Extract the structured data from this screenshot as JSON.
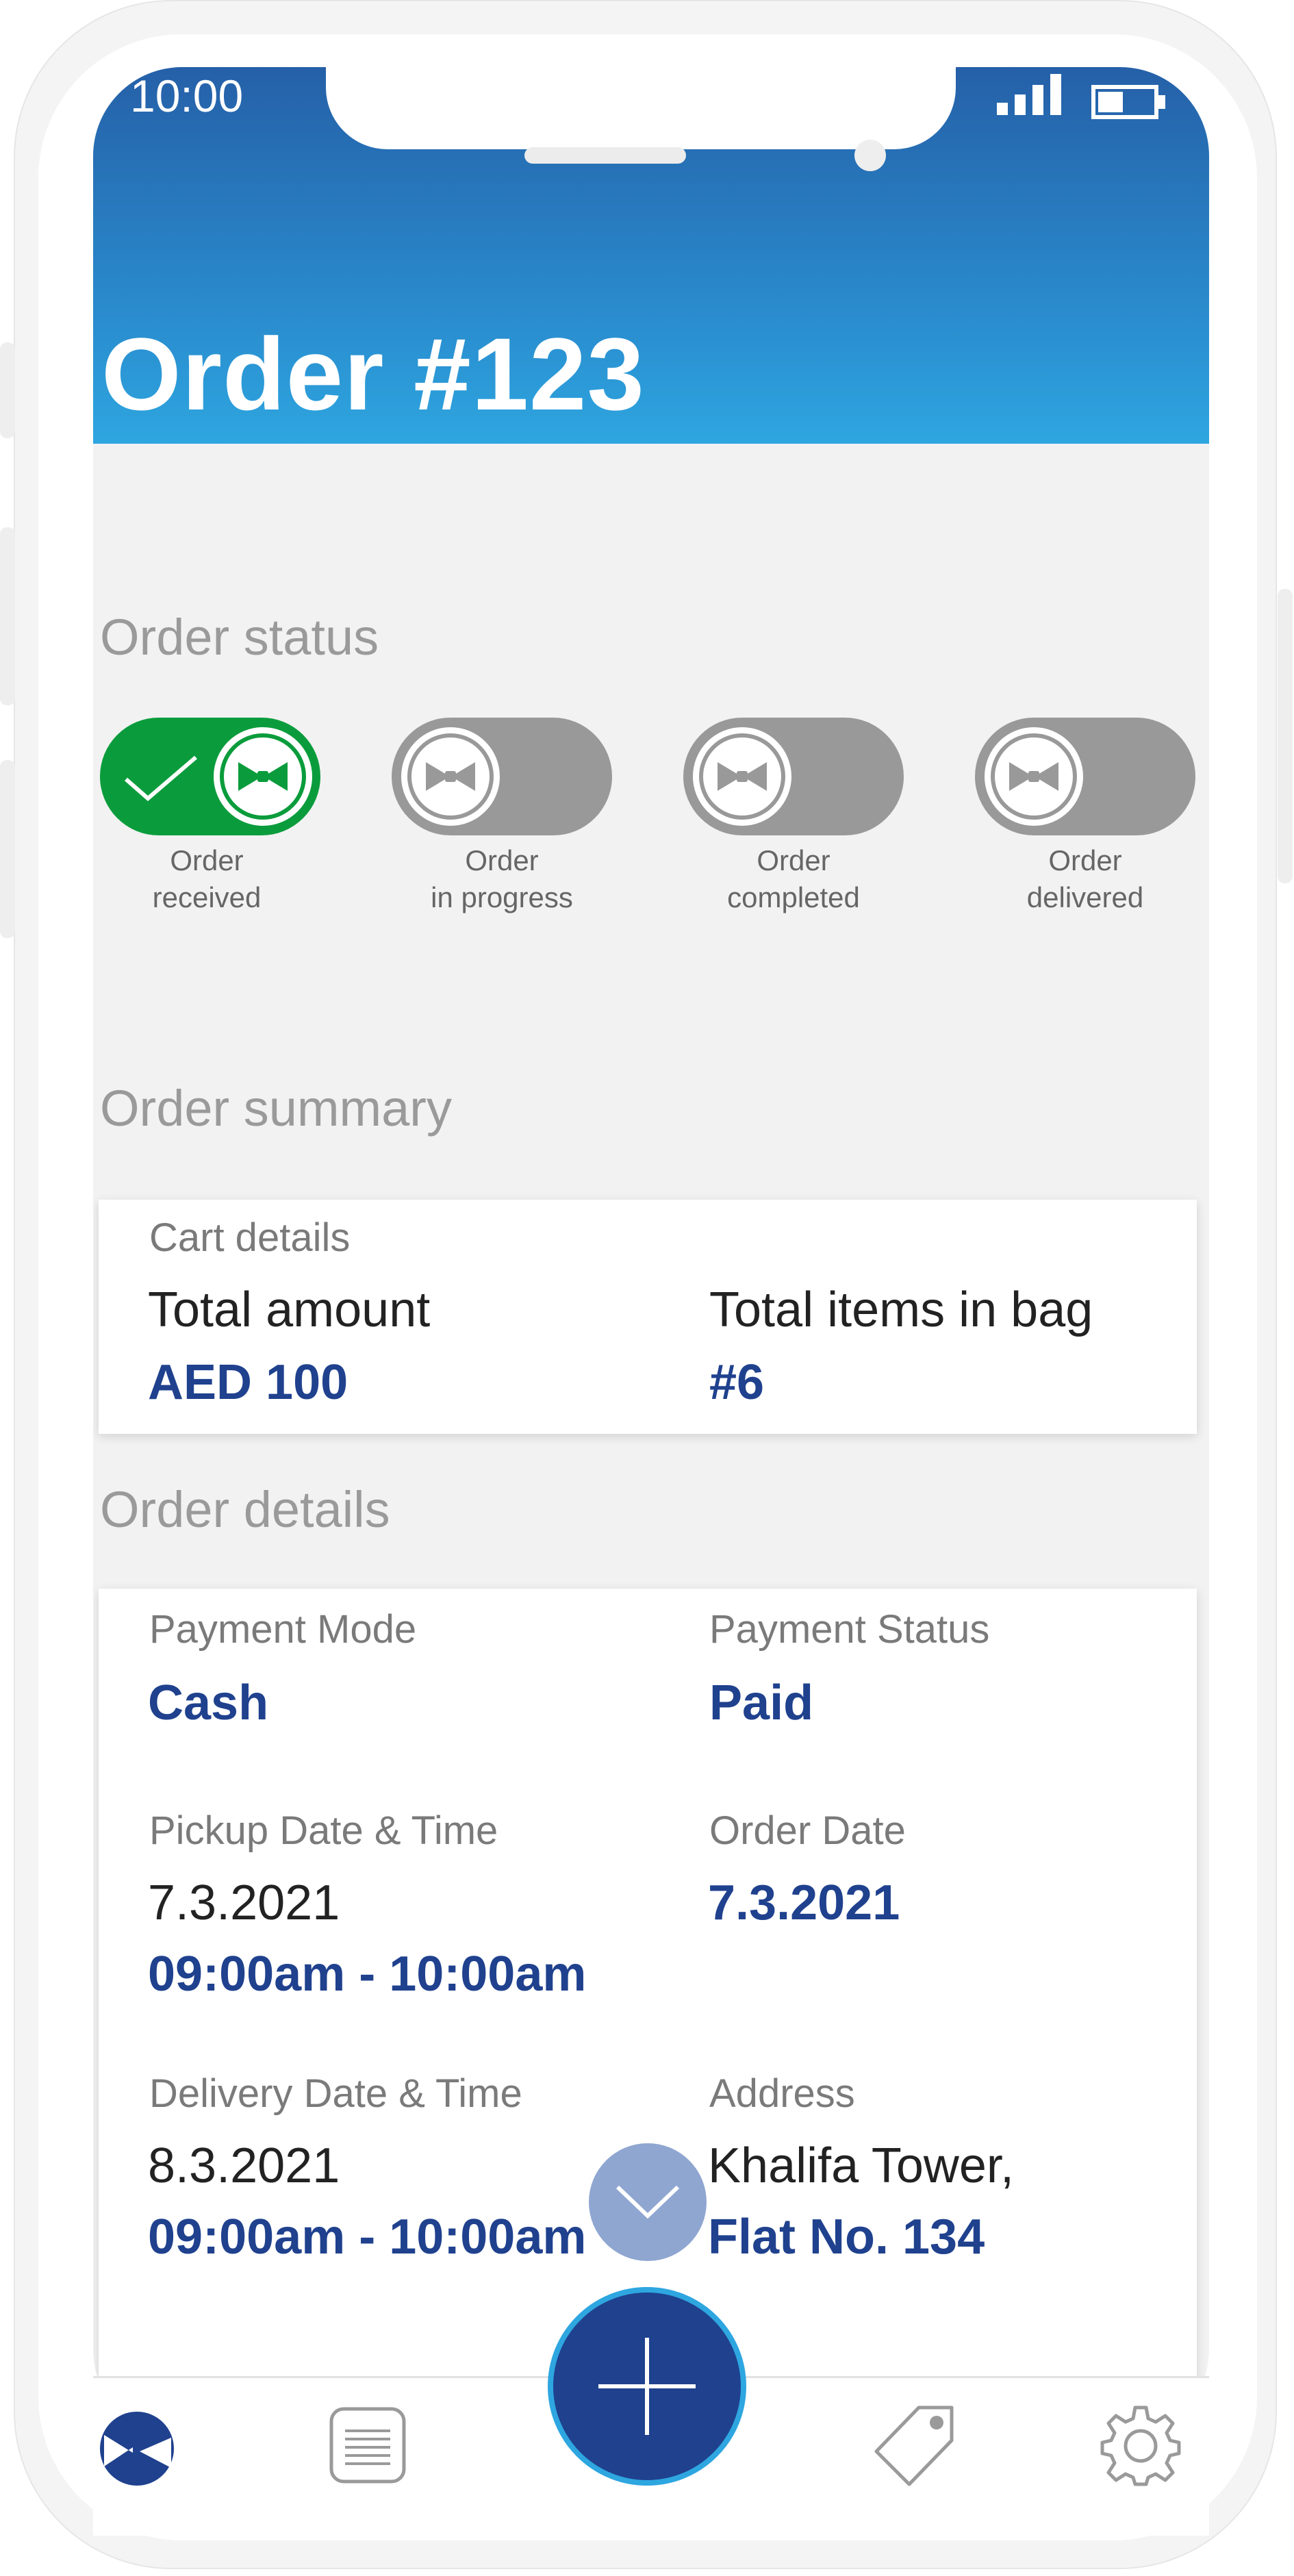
{
  "status_bar": {
    "time": "10:00"
  },
  "header": {
    "title": "Order #123"
  },
  "order_status": {
    "title": "Order status",
    "steps": [
      {
        "line1": "Order",
        "line2": "received",
        "active": true
      },
      {
        "line1": "Order",
        "line2": "in progress",
        "active": false
      },
      {
        "line1": "Order",
        "line2": "completed",
        "active": false
      },
      {
        "line1": "Order",
        "line2": "delivered",
        "active": false
      }
    ]
  },
  "order_summary": {
    "title": "Order summary",
    "card_label": "Cart details",
    "total_amount_label": "Total amount",
    "total_amount_value": "AED 100",
    "total_items_label": "Total items in bag",
    "total_items_value": "#6"
  },
  "order_details": {
    "title": "Order details",
    "payment_mode_label": "Payment Mode",
    "payment_mode_value": "Cash",
    "payment_status_label": "Payment Status",
    "payment_status_value": "Paid",
    "pickup_label": "Pickup Date & Time",
    "pickup_date": "7.3.2021",
    "pickup_time": "09:00am - 10:00am",
    "order_date_label": "Order Date",
    "order_date_value": "7.3.2021",
    "delivery_label": "Delivery Date & Time",
    "delivery_date": "8.3.2021",
    "delivery_time": "09:00am - 10:00am",
    "address_label": "Address",
    "address_line1": "Khalifa Tower,",
    "address_line2": "Flat No. 134"
  },
  "colors": {
    "header_top": "#2560a8",
    "header_bottom": "#2ea6e0",
    "active_green": "#0a9c3c",
    "inactive_grey": "#999999",
    "value_blue": "#1f418e",
    "fab_ring": "#2ea6e0"
  },
  "nav": {
    "items": [
      "home-icon",
      "orders-list-icon",
      "add-icon",
      "offers-tag-icon",
      "settings-gear-icon"
    ]
  }
}
